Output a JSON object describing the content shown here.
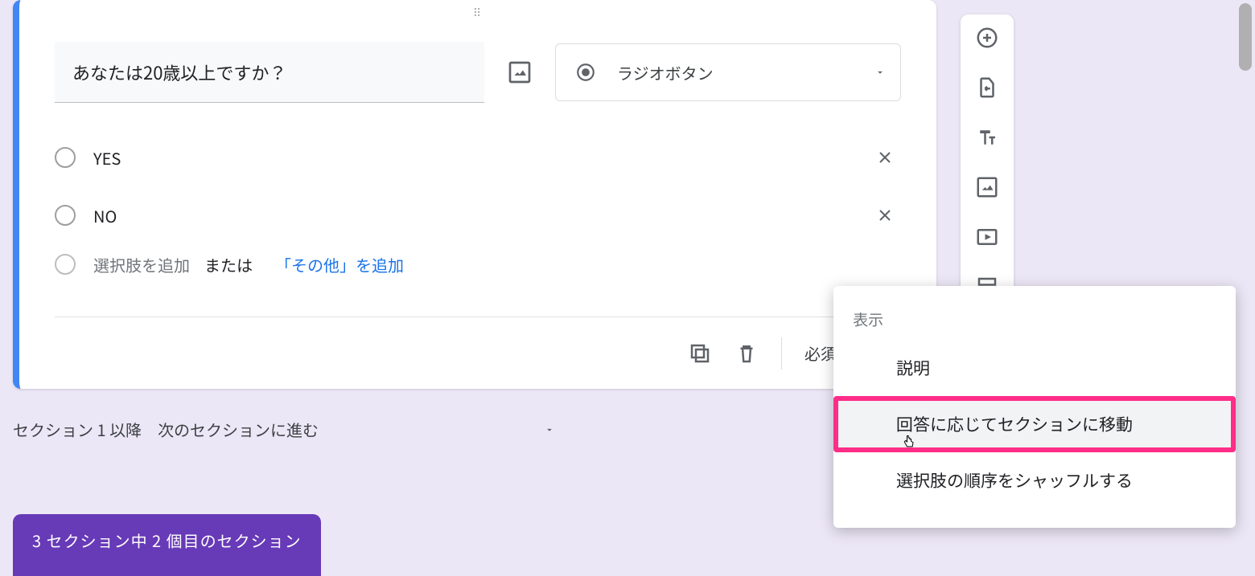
{
  "question": {
    "title": "あなたは20歳以上ですか？",
    "type_label": "ラジオボタン",
    "options": [
      "YES",
      "NO"
    ],
    "add_option_placeholder": "選択肢を追加",
    "add_or": "または",
    "add_other": "「その他」を追加",
    "required_label": "必須"
  },
  "section_nav": {
    "prefix": "セクション 1 以降",
    "dest": "次のセクションに進む"
  },
  "section_badge": "3 セクション中 2 個目のセクション",
  "popup": {
    "header": "表示",
    "items": {
      "description": "説明",
      "go_to_section": "回答に応じてセクションに移動",
      "shuffle": "選択肢の順序をシャッフルする"
    }
  },
  "toolbar_icons": [
    "add",
    "import",
    "title",
    "image",
    "video",
    "section"
  ]
}
